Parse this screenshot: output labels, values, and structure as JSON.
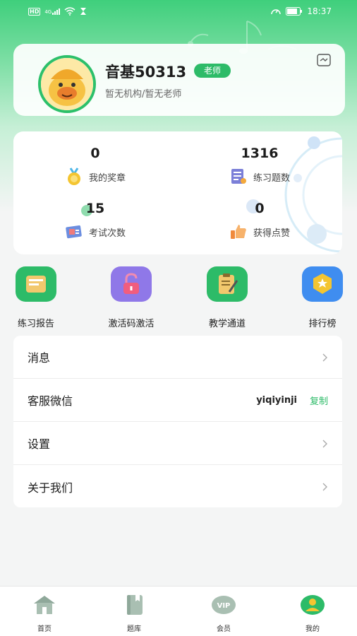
{
  "status_bar": {
    "network_badge": "HD",
    "signal_label": "4G",
    "time": "18:37"
  },
  "profile": {
    "username": "音基50313",
    "role": "老师",
    "organization": "暂无机构/暂无老师"
  },
  "stats": [
    {
      "value": "0",
      "label": "我的奖章",
      "icon": "medal-icon"
    },
    {
      "value": "1316",
      "label": "练习题数",
      "icon": "exercise-doc-icon"
    },
    {
      "value": "15",
      "label": "考试次数",
      "icon": "exam-card-icon"
    },
    {
      "value": "0",
      "label": "获得点赞",
      "icon": "thumbs-up-icon"
    }
  ],
  "shortcuts": [
    {
      "label": "练习报告",
      "icon": "report-folder-icon",
      "color": "#2dbb68"
    },
    {
      "label": "激活码激活",
      "icon": "unlock-icon",
      "color": "#8f78e8"
    },
    {
      "label": "教学通道",
      "icon": "clipboard-icon",
      "color": "#2dbb68"
    },
    {
      "label": "排行榜",
      "icon": "ranking-badge-icon",
      "color": "#3f8df0"
    }
  ],
  "menu": {
    "messages": "消息",
    "customer_service": "客服微信",
    "wechat_id": "yiqiyinji",
    "copy": "复制",
    "settings": "设置",
    "about": "关于我们"
  },
  "tabs": [
    {
      "label": "首页",
      "icon": "home-icon"
    },
    {
      "label": "题库",
      "icon": "book-icon"
    },
    {
      "label": "会员",
      "icon": "vip-icon"
    },
    {
      "label": "我的",
      "icon": "profile-icon",
      "active": true
    }
  ],
  "colors": {
    "accent": "#2dbb68",
    "header_gradient_top": "#3fcf7c"
  }
}
